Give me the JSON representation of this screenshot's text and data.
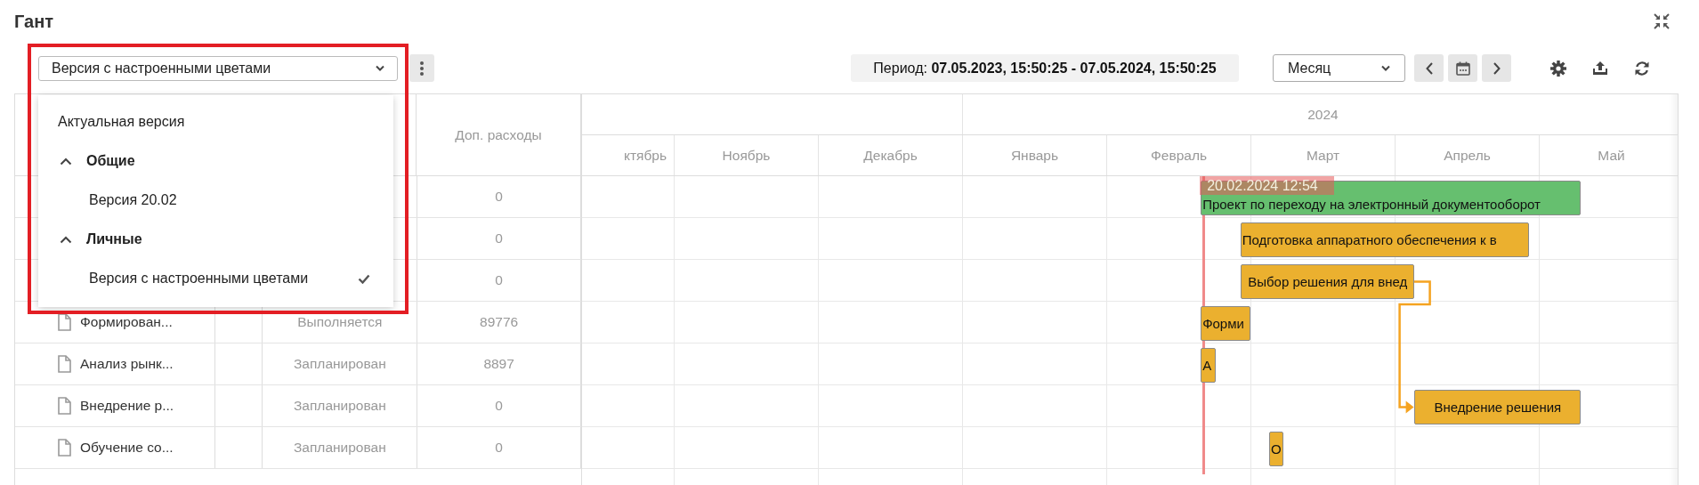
{
  "title": "Гант",
  "version_select": {
    "value": "Версия с настроенными цветами",
    "expanded": true
  },
  "version_menu": [
    {
      "kind": "item",
      "label": "Актуальная версия",
      "selected": false
    },
    {
      "kind": "group",
      "label": "Общие",
      "expanded": true,
      "children": [
        {
          "kind": "item",
          "label": "Версия 20.02",
          "selected": false
        }
      ]
    },
    {
      "kind": "group",
      "label": "Личные",
      "expanded": true,
      "children": [
        {
          "kind": "item",
          "label": "Версия с настроенными цветами",
          "selected": true
        }
      ]
    }
  ],
  "period": "Период: **07.05.2023, 15:50:25 - 07.05.2024, 15:50:25**",
  "scale_select": {
    "value": "Месяц"
  },
  "table": {
    "cost_header": "Доп. расходы",
    "rows": [
      {
        "cost": "0"
      },
      {
        "cost": "0"
      },
      {
        "cost": "0"
      },
      {
        "name": "Формирован...",
        "status": "Выполняется",
        "cost": "89776"
      },
      {
        "name": "Анализ рынк...",
        "status": "Запланирован",
        "cost": "8897"
      },
      {
        "name": "Внедрение р...",
        "status": "Запланирован",
        "cost": "0"
      },
      {
        "name": "Обучение со...",
        "status": "Запланирован",
        "cost": "0"
      }
    ]
  },
  "timeline": {
    "years": [
      {
        "months": [
          "ктябрь",
          "Ноябрь",
          "Декабрь"
        ]
      },
      {
        "label": "2024",
        "months": [
          "Январь",
          "Февраль",
          "Март",
          "Апрель",
          "Май"
        ]
      }
    ]
  },
  "today": {
    "label": "20.02.2024 12:54"
  },
  "bars": [
    {
      "label": "Проект по переходу на электронный документооборот",
      "color": "#66bf6f"
    },
    {
      "label": "Подготовка аппаратного обеспечения к в",
      "color": "#ebb02f"
    },
    {
      "label": "Выбор решения для внед",
      "color": "#ebb02f"
    },
    {
      "label": "Форми",
      "color": "#ebb02f"
    },
    {
      "label": "А",
      "color": "#ebb02f"
    },
    {
      "label": "Внедрение решения",
      "color": "#ebb02f"
    },
    {
      "label": "О",
      "color": "#ebb02f"
    }
  ]
}
